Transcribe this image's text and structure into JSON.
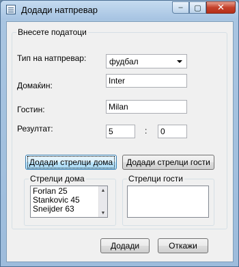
{
  "window": {
    "title": "Додади натпревар",
    "controls": {
      "minimize": "–",
      "maximize": "▢",
      "close": "✕"
    }
  },
  "form": {
    "group_title": "Внесете податоци",
    "match_type_label": "Тип на натпревар:",
    "match_type_value": "фудбал",
    "home_label": "Домаќин:",
    "home_value": "Inter",
    "guest_label": "Гостин:",
    "guest_value": "Milan",
    "result_label": "Резултат:",
    "result_home": "5",
    "result_separator": ":",
    "result_guest": "0"
  },
  "buttons": {
    "add_home_scorers": "Додади стрелци дома",
    "add_guest_scorers": "Додади стрелци гости",
    "add": "Додади",
    "cancel": "Откажи"
  },
  "home_scorers": {
    "title": "Стрелци дома",
    "items": [
      "Forlan 25",
      "Stankovic 45",
      "Sneijder 63"
    ]
  },
  "guest_scorers": {
    "title": "Стрелци гости",
    "items": []
  }
}
